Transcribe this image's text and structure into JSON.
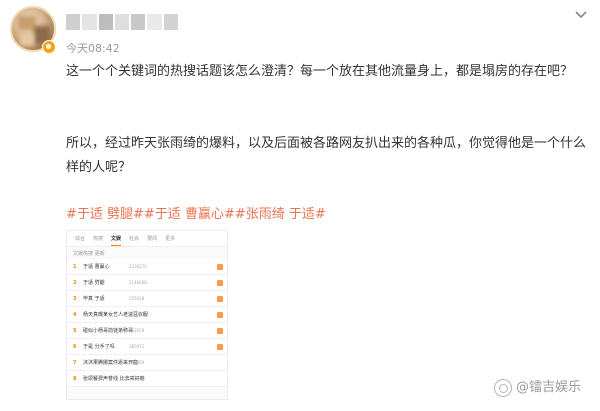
{
  "post": {
    "author_name": "",
    "timestamp": "今天08:42",
    "paragraph1": "这一个个关键词的热搜话题该怎么澄清？每一个放在其他流量身上，都是塌房的存在吧？",
    "paragraph2": "所以，经过昨天张雨绮的爆料，以及后面被各路网友扒出来的各种瓜，你觉得他是一个什么样的人呢？",
    "hashtags": "#于适 劈腿##于适 曹赢心##张雨绮 于适#",
    "hashtag_color": "#eb7350",
    "more_icon": "chevron-down-icon"
  },
  "screenshot": {
    "tabs": [
      {
        "label": "综合",
        "active": false
      },
      {
        "label": "热搜",
        "active": false
      },
      {
        "label": "文娱",
        "active": true
      },
      {
        "label": "社会",
        "active": false
      },
      {
        "label": "要闻",
        "active": false
      },
      {
        "label": "更多",
        "active": false
      }
    ],
    "header_text": "文娱热搜  更新",
    "rows": [
      {
        "rank": "1",
        "title": "于适 曹赢心",
        "count": "2336270"
      },
      {
        "rank": "2",
        "title": "于适 劈腿",
        "count": "1146608"
      },
      {
        "rank": "3",
        "title": "毕真 于适",
        "count": "555028"
      },
      {
        "rank": "4",
        "title": "杨天真曝某女艺人老进豆衣服",
        "count": "462291"
      },
      {
        "rank": "5",
        "title": "碰似小杨哥前徒弟称哥",
        "count": "452059"
      },
      {
        "rank": "6",
        "title": "于是 分手了吗",
        "count": "385972"
      },
      {
        "rank": "7",
        "title": "沐沐果腾挪案件逐来开庭",
        "count": "337989"
      },
      {
        "rank": "8",
        "title": "张颂餐费声誉线 比去来好瘾",
        "count": "282787"
      }
    ],
    "accent_color": "#ff8200"
  },
  "watermark": {
    "text": "@镭吉娱乐",
    "icon": "watermark-logo-icon"
  }
}
